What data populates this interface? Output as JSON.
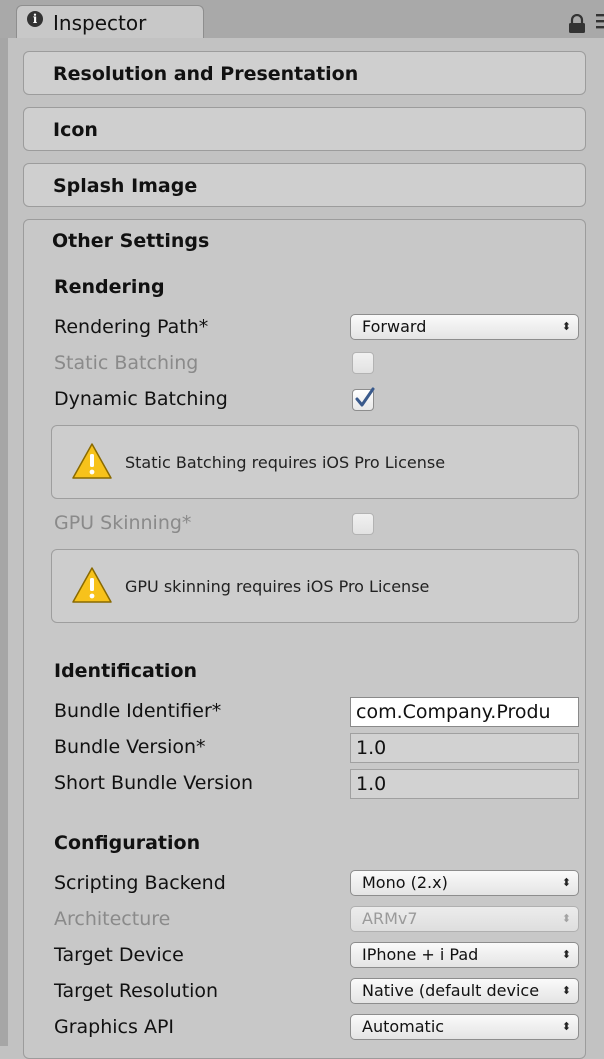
{
  "tab": {
    "title": "Inspector"
  },
  "sections": {
    "resolution": "Resolution and Presentation",
    "icon": "Icon",
    "splash": "Splash Image",
    "other": "Other Settings"
  },
  "rendering": {
    "heading": "Rendering",
    "rendering_path_label": "Rendering Path*",
    "rendering_path_value": "Forward",
    "static_batching_label": "Static Batching",
    "static_batching_checked": false,
    "dynamic_batching_label": "Dynamic Batching",
    "dynamic_batching_checked": true,
    "static_warning": "Static Batching requires iOS Pro License",
    "gpu_skinning_label": "GPU Skinning*",
    "gpu_skinning_checked": false,
    "gpu_warning": "GPU skinning requires iOS Pro License"
  },
  "identification": {
    "heading": "Identification",
    "bundle_identifier_label": "Bundle Identifier*",
    "bundle_identifier_value": "com.Company.Produ",
    "bundle_version_label": "Bundle Version*",
    "bundle_version_value": "1.0",
    "short_bundle_version_label": "Short Bundle Version",
    "short_bundle_version_value": "1.0"
  },
  "configuration": {
    "heading": "Configuration",
    "scripting_backend_label": "Scripting Backend",
    "scripting_backend_value": "Mono (2.x)",
    "architecture_label": "Architecture",
    "architecture_value": "ARMv7",
    "target_device_label": "Target Device",
    "target_device_value": "IPhone + i Pad",
    "target_resolution_label": "Target Resolution",
    "target_resolution_value": "Native (default device",
    "graphics_api_label": "Graphics API",
    "graphics_api_value": "Automatic"
  },
  "icons": {
    "tab": "info-icon",
    "lock": "lock-icon",
    "menu": "menu-icon",
    "warning": "warning-icon",
    "dropdown": "dropdown-arrows-icon",
    "check": "checkmark-icon"
  },
  "colors": {
    "check": "#3a5a8c",
    "warning_fill": "#f7c21b"
  }
}
